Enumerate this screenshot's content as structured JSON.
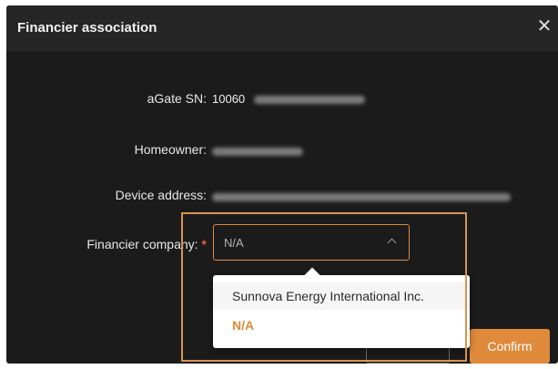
{
  "dialog": {
    "title": "Financier association",
    "close_icon": "close-icon"
  },
  "fields": {
    "sn_label": "aGate SN:",
    "sn_value": "10060",
    "homeowner_label": "Homeowner:",
    "address_label": "Device address:",
    "financier_label": "Financier company:",
    "required_mark": "*"
  },
  "financier_select": {
    "value": "N/A",
    "options": [
      "Sunnova Energy International Inc.",
      "N/A"
    ],
    "selected_index": 1
  },
  "buttons": {
    "confirm": "Confirm"
  },
  "colors": {
    "accent": "#e08a3c",
    "dialog_bg": "#1b1b1b",
    "required": "#e35a4f"
  }
}
